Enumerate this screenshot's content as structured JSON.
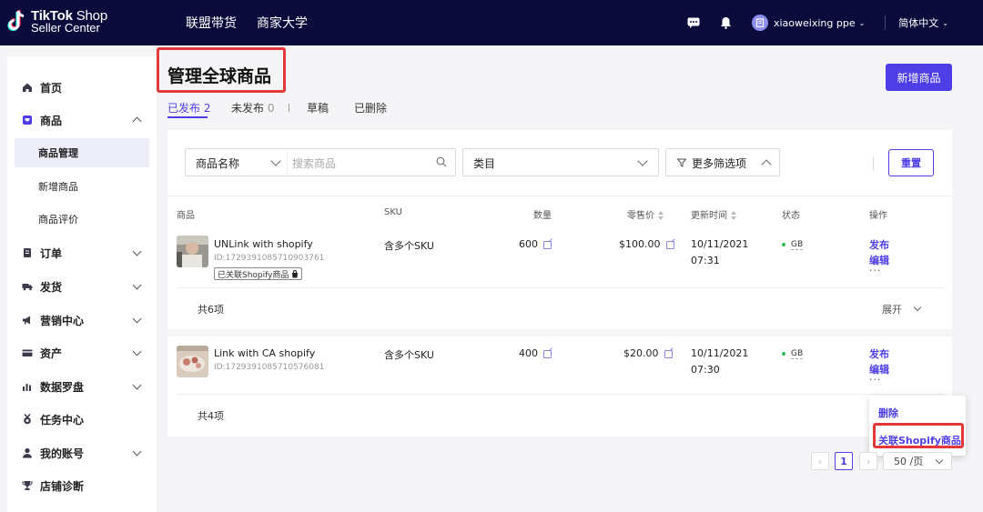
{
  "header": {
    "logo_line1_bold": "TikTok",
    "logo_line1_rest": " Shop",
    "logo_line2": "Seller Center",
    "nav": [
      "联盟带货",
      "商家大学"
    ],
    "user_name": "xiaoweixing ppe",
    "language": "简体中文",
    "icons": [
      "chat-icon",
      "bell-icon",
      "store-icon"
    ]
  },
  "sidebar": {
    "items": [
      {
        "label": "首页",
        "icon": "home-icon",
        "expandable": false
      },
      {
        "label": "商品",
        "icon": "product-icon",
        "expandable": true,
        "expanded": true
      },
      {
        "label": "订单",
        "icon": "order-icon",
        "expandable": true
      },
      {
        "label": "发货",
        "icon": "truck-icon",
        "expandable": true
      },
      {
        "label": "营销中心",
        "icon": "megaphone-icon",
        "expandable": true
      },
      {
        "label": "资产",
        "icon": "card-icon",
        "expandable": true
      },
      {
        "label": "数据罗盘",
        "icon": "chart-icon",
        "expandable": true
      },
      {
        "label": "任务中心",
        "icon": "medal-icon",
        "expandable": false
      },
      {
        "label": "我的账号",
        "icon": "user-icon",
        "expandable": true
      },
      {
        "label": "店铺诊断",
        "icon": "trophy-icon",
        "expandable": false
      }
    ],
    "product_sub": [
      "商品管理",
      "新增商品",
      "商品评价"
    ],
    "active_sub": "商品管理"
  },
  "main": {
    "title": "管理全球商品",
    "add_button": "新增商品",
    "tabs": [
      {
        "label": "已发布",
        "count": "2",
        "active": true
      },
      {
        "label": "未发布",
        "count": "0",
        "active": false
      },
      {
        "label": "草稿",
        "count": "",
        "active": false
      },
      {
        "label": "已删除",
        "count": "",
        "active": false
      }
    ],
    "filters": {
      "field_select": "商品名称",
      "search_placeholder": "搜索商品",
      "category_select": "类目",
      "more_filters": "更多筛选项",
      "reset": "重置"
    },
    "columns": [
      "商品",
      "SKU",
      "数量",
      "零售价",
      "更新时间",
      "状态",
      "操作"
    ],
    "products": [
      {
        "name": "UNLink with shopify",
        "id": "ID:1729391085710903761",
        "tag": "已关联Shopify商品",
        "sku": "含多个SKU",
        "qty": "600",
        "price": "$100.00",
        "date": "10/11/2021",
        "time": "07:31",
        "status": "GB",
        "action1": "发布",
        "action2": "编辑",
        "more": "...",
        "total": "共6项",
        "expand": "展开"
      },
      {
        "name": "Link with CA shopify",
        "id": "ID:1729391085710576081",
        "tag": "",
        "sku": "含多个SKU",
        "qty": "400",
        "price": "$20.00",
        "date": "10/11/2021",
        "time": "07:30",
        "status": "GB",
        "action1": "发布",
        "action2": "编辑",
        "more": "...",
        "total": "共4项",
        "expand": ""
      }
    ],
    "popover": [
      "删除",
      "关联Shopify商品"
    ],
    "pagination": {
      "current": "1",
      "page_size": "50 /页"
    }
  },
  "colors": {
    "topbar": "#0b0b3b",
    "accent": "#4e3ee6",
    "highlight": "#e23a3a",
    "status_green": "#2fbf5a"
  }
}
